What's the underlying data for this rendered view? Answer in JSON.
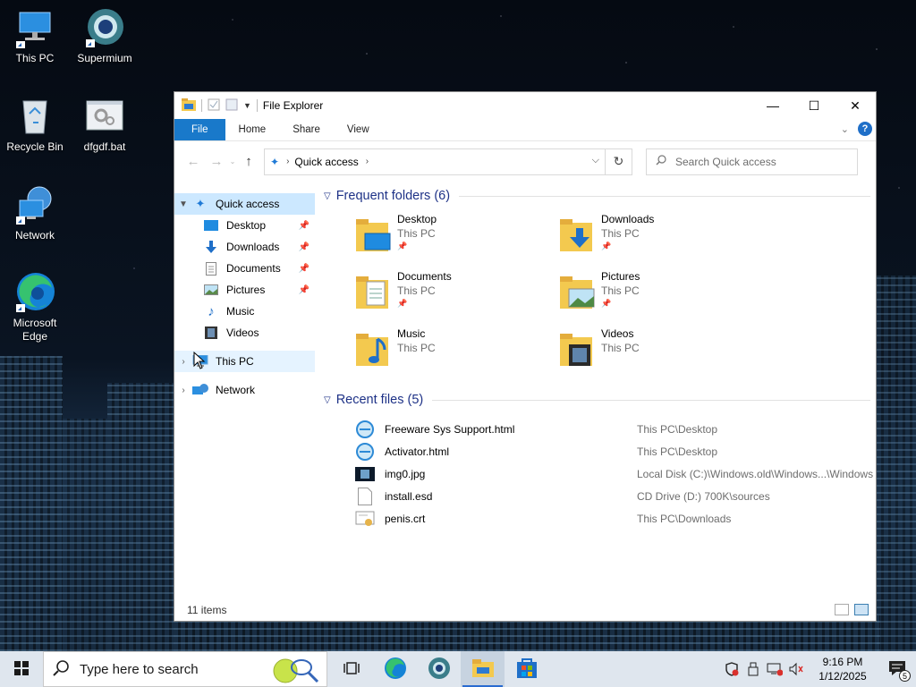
{
  "desktop": {
    "icons": [
      {
        "label": "This PC",
        "icon": "this-pc-icon"
      },
      {
        "label": "Supermium",
        "icon": "supermium-icon"
      },
      {
        "label": "Recycle Bin",
        "icon": "recycle-bin-icon"
      },
      {
        "label": "dfgdf.bat",
        "icon": "batch-file-icon"
      },
      {
        "label": "Network",
        "icon": "network-icon"
      },
      {
        "label": "Microsoft Edge",
        "icon": "edge-icon"
      }
    ]
  },
  "window": {
    "title": "File Explorer",
    "controls": {
      "minimize": "—",
      "maximize": "☐",
      "close": "✕"
    },
    "ribbon_tabs": [
      "File",
      "Home",
      "Share",
      "View"
    ],
    "address": {
      "location": "Quick access",
      "search_placeholder": "Search Quick access"
    },
    "nav": {
      "quick_access": "Quick access",
      "pinned": [
        {
          "label": "Desktop",
          "pinned": true
        },
        {
          "label": "Downloads",
          "pinned": true
        },
        {
          "label": "Documents",
          "pinned": true
        },
        {
          "label": "Pictures",
          "pinned": true
        },
        {
          "label": "Music",
          "pinned": false
        },
        {
          "label": "Videos",
          "pinned": false
        }
      ],
      "this_pc": "This PC",
      "network": "Network"
    },
    "frequent": {
      "header": "Frequent folders (6)",
      "folders": [
        {
          "name": "Desktop",
          "location": "This PC",
          "pinned": true
        },
        {
          "name": "Downloads",
          "location": "This PC",
          "pinned": true
        },
        {
          "name": "Documents",
          "location": "This PC",
          "pinned": true
        },
        {
          "name": "Pictures",
          "location": "This PC",
          "pinned": true
        },
        {
          "name": "Music",
          "location": "This PC",
          "pinned": false
        },
        {
          "name": "Videos",
          "location": "This PC",
          "pinned": false
        }
      ]
    },
    "recent": {
      "header": "Recent files (5)",
      "files": [
        {
          "name": "Freeware Sys Support.html",
          "path": "This PC\\Desktop",
          "icon": "html-file-icon"
        },
        {
          "name": "Activator.html",
          "path": "This PC\\Desktop",
          "icon": "html-file-icon"
        },
        {
          "name": "img0.jpg",
          "path": "Local Disk (C:)\\Windows.old\\Windows...\\Windows",
          "icon": "image-file-icon"
        },
        {
          "name": "install.esd",
          "path": "CD Drive (D:) 700K\\sources",
          "icon": "generic-file-icon"
        },
        {
          "name": "penis.crt",
          "path": "This PC\\Downloads",
          "icon": "certificate-file-icon"
        }
      ]
    },
    "status": "11 items"
  },
  "taskbar": {
    "search_text": "Type here to search",
    "time": "9:16 PM",
    "date": "1/12/2025",
    "notification_count": "5"
  },
  "colors": {
    "accent": "#1979ca",
    "header_text": "#1e3287",
    "selected": "#cce8ff",
    "folder": "#f3c94f"
  }
}
